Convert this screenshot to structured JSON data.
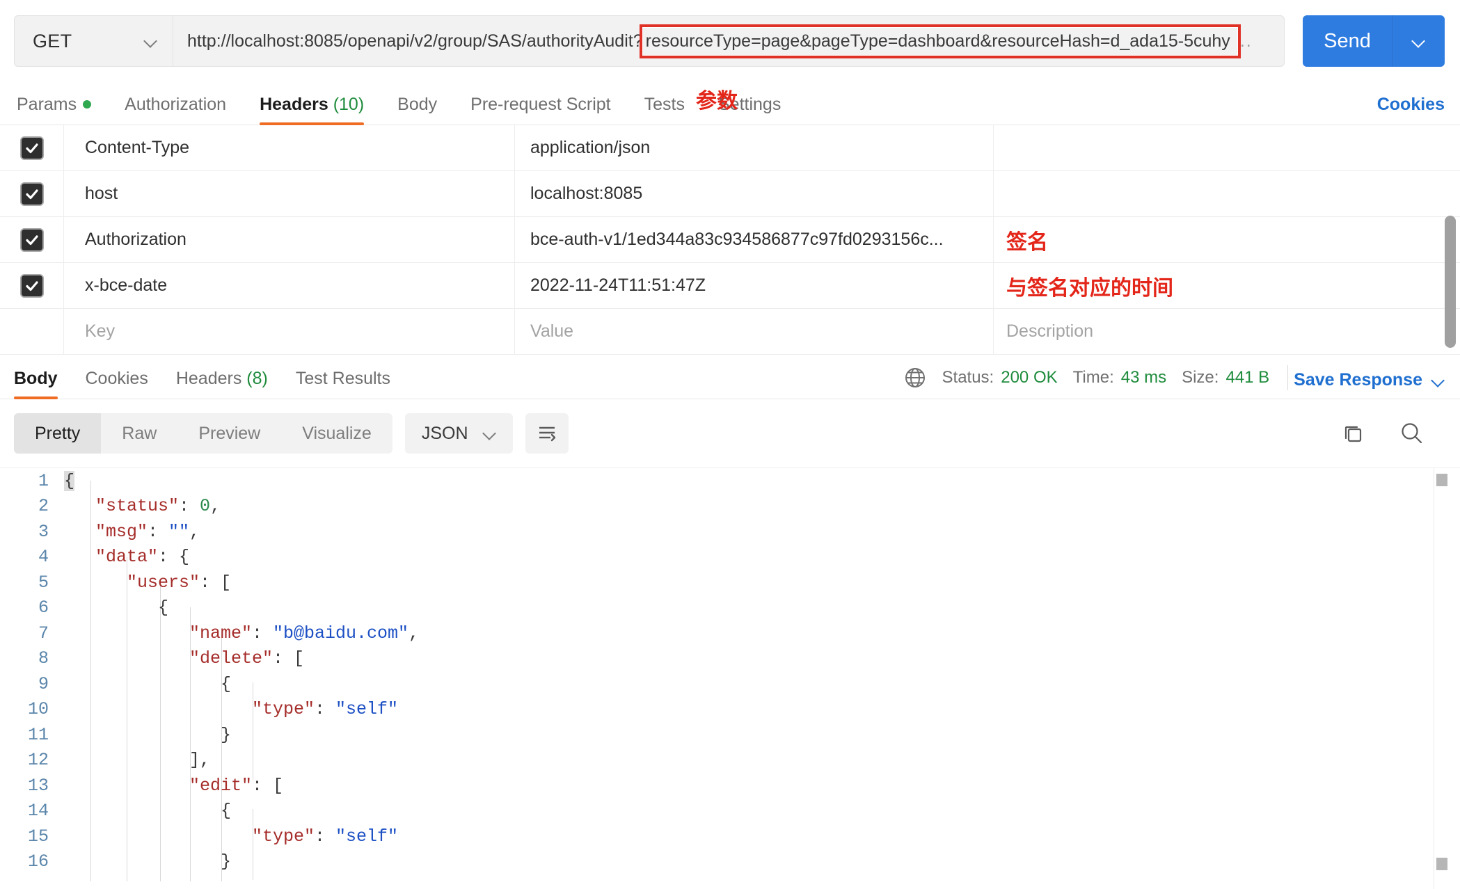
{
  "request": {
    "method": "GET",
    "url_prefix": "http://localhost:8085/openapi/v2/group/SAS/authorityAudit?",
    "url_highlighted": "resourceType=page&pageType=dashboard&resourceHash=d_ada15-5cuhy",
    "url_tail": "..",
    "send_label": "Send"
  },
  "request_tabs": [
    {
      "label": "Params",
      "dot": true
    },
    {
      "label": "Authorization"
    },
    {
      "label": "Headers",
      "count": "(10)",
      "active": true
    },
    {
      "label": "Body"
    },
    {
      "label": "Pre-request Script"
    },
    {
      "label": "Tests"
    },
    {
      "label": "Settings"
    }
  ],
  "annotations": {
    "params": "参数",
    "signature": "签名",
    "signature_time": "与签名对应的时间"
  },
  "cookies_link": "Cookies",
  "headers_table": {
    "placeholders": {
      "key": "Key",
      "value": "Value",
      "description": "Description"
    },
    "rows": [
      {
        "checked": true,
        "key": "Content-Type",
        "value": "application/json",
        "description": ""
      },
      {
        "checked": true,
        "key": "host",
        "value": "localhost:8085",
        "description": ""
      },
      {
        "checked": true,
        "key": "Authorization",
        "value": "bce-auth-v1/1ed344a83c934586877c97fd0293156c...",
        "description": "签名"
      },
      {
        "checked": true,
        "key": "x-bce-date",
        "value": "2022-11-24T11:51:47Z",
        "description": "与签名对应的时间"
      }
    ]
  },
  "response": {
    "tabs": [
      {
        "label": "Body",
        "active": true
      },
      {
        "label": "Cookies"
      },
      {
        "label": "Headers",
        "count": "(8)"
      },
      {
        "label": "Test Results"
      }
    ],
    "meta": {
      "status_label": "Status:",
      "status_value": "200 OK",
      "time_label": "Time:",
      "time_value": "43 ms",
      "size_label": "Size:",
      "size_value": "441 B",
      "save_response": "Save Response"
    },
    "view_modes": [
      {
        "label": "Pretty",
        "active": true
      },
      {
        "label": "Raw"
      },
      {
        "label": "Preview"
      },
      {
        "label": "Visualize"
      }
    ],
    "format": "JSON"
  },
  "colors": {
    "accent_blue": "#2f7ce0",
    "tab_underline": "#ef6c25",
    "annotation_red": "#e32619",
    "status_green": "#1f8c3d",
    "json_key": "#a52d2a",
    "json_string": "#1c4fc4",
    "json_number": "#2a8a4a",
    "line_number": "#5b86ab"
  },
  "code": {
    "lines": [
      {
        "n": "1",
        "indent": 0,
        "tokens": [
          {
            "t": "p",
            "v": "{"
          }
        ]
      },
      {
        "n": "2",
        "indent": 1,
        "tokens": [
          {
            "t": "k",
            "v": "\"status\""
          },
          {
            "t": "p",
            "v": ": "
          },
          {
            "t": "n",
            "v": "0"
          },
          {
            "t": "p",
            "v": ","
          }
        ]
      },
      {
        "n": "3",
        "indent": 1,
        "tokens": [
          {
            "t": "k",
            "v": "\"msg\""
          },
          {
            "t": "p",
            "v": ": "
          },
          {
            "t": "s",
            "v": "\"\""
          },
          {
            "t": "p",
            "v": ","
          }
        ]
      },
      {
        "n": "4",
        "indent": 1,
        "tokens": [
          {
            "t": "k",
            "v": "\"data\""
          },
          {
            "t": "p",
            "v": ": {"
          }
        ]
      },
      {
        "n": "5",
        "indent": 2,
        "tokens": [
          {
            "t": "k",
            "v": "\"users\""
          },
          {
            "t": "p",
            "v": ": ["
          }
        ]
      },
      {
        "n": "6",
        "indent": 3,
        "tokens": [
          {
            "t": "p",
            "v": "{"
          }
        ]
      },
      {
        "n": "7",
        "indent": 4,
        "tokens": [
          {
            "t": "k",
            "v": "\"name\""
          },
          {
            "t": "p",
            "v": ": "
          },
          {
            "t": "s",
            "v": "\"b@baidu.com\""
          },
          {
            "t": "p",
            "v": ","
          }
        ]
      },
      {
        "n": "8",
        "indent": 4,
        "tokens": [
          {
            "t": "k",
            "v": "\"delete\""
          },
          {
            "t": "p",
            "v": ": ["
          }
        ]
      },
      {
        "n": "9",
        "indent": 5,
        "tokens": [
          {
            "t": "p",
            "v": "{"
          }
        ]
      },
      {
        "n": "10",
        "indent": 6,
        "tokens": [
          {
            "t": "k",
            "v": "\"type\""
          },
          {
            "t": "p",
            "v": ": "
          },
          {
            "t": "s",
            "v": "\"self\""
          }
        ]
      },
      {
        "n": "11",
        "indent": 5,
        "tokens": [
          {
            "t": "p",
            "v": "}"
          }
        ]
      },
      {
        "n": "12",
        "indent": 4,
        "tokens": [
          {
            "t": "p",
            "v": "],"
          }
        ]
      },
      {
        "n": "13",
        "indent": 4,
        "tokens": [
          {
            "t": "k",
            "v": "\"edit\""
          },
          {
            "t": "p",
            "v": ": ["
          }
        ]
      },
      {
        "n": "14",
        "indent": 5,
        "tokens": [
          {
            "t": "p",
            "v": "{"
          }
        ]
      },
      {
        "n": "15",
        "indent": 6,
        "tokens": [
          {
            "t": "k",
            "v": "\"type\""
          },
          {
            "t": "p",
            "v": ": "
          },
          {
            "t": "s",
            "v": "\"self\""
          }
        ]
      },
      {
        "n": "16",
        "indent": 5,
        "tokens": [
          {
            "t": "p",
            "v": "}"
          }
        ]
      }
    ]
  }
}
